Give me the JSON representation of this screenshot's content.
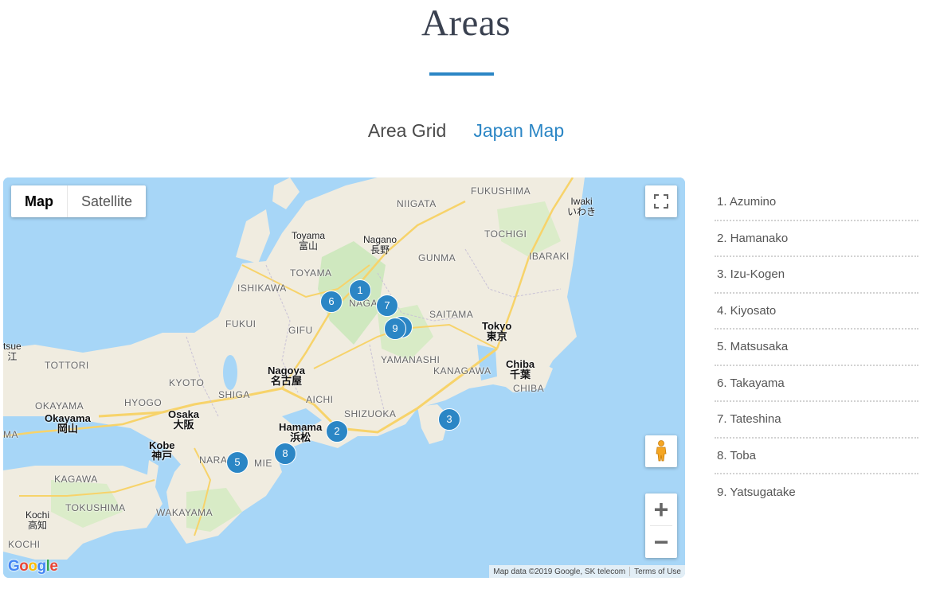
{
  "page": {
    "title": "Areas"
  },
  "tabs": [
    {
      "label": "Area Grid",
      "active": false
    },
    {
      "label": "Japan Map",
      "active": true
    }
  ],
  "colors": {
    "accent": "#2b86c5",
    "water": "#a7d6f7",
    "land": "#f0ece0",
    "park": "#cfe8bf",
    "road": "#f7d36a"
  },
  "map": {
    "type_buttons": [
      "Map",
      "Satellite"
    ],
    "selected_type": "Map",
    "icons": {
      "fullscreen": "fullscreen-icon",
      "pegman": "pegman-icon",
      "zoom_in": "zoom-in-icon",
      "zoom_out": "zoom-out-icon"
    },
    "zoom_in_label": "+",
    "zoom_out_label": "−",
    "google_logo": "Google",
    "attribution": [
      "Map data ©2019 Google, SK telecom",
      "Terms of Use"
    ],
    "markers": [
      "1",
      "2",
      "3",
      "5",
      "6",
      "7",
      "8",
      "9"
    ],
    "labels": {
      "fukushima": "FUKUSHIMA",
      "niigata": "NIIGATA",
      "iwaki": "Iwaki",
      "iwaki_jp": "いわき",
      "tochigi": "TOCHIGI",
      "ibaraki": "IBARAKI",
      "toyama_city": "Toyama",
      "toyama_city_jp": "富山",
      "nagano": "Nagano",
      "nagano_jp": "長野",
      "gunma": "GUNMA",
      "toyama": "TOYAMA",
      "ishikawa": "ISHIKAWA",
      "naga": "NAGA",
      "saitama": "SAITAMA",
      "fukui": "FUKUI",
      "gifu": "GIFU",
      "tokyo": "Tokyo",
      "tokyo_jp": "東京",
      "tsue": "tsue",
      "tsue_jp": "江",
      "tottori": "TOTTORI",
      "yamanashi": "YAMANASHI",
      "kanagawa": "KANAGAWA",
      "chiba_city": "Chiba",
      "chiba_city_jp": "千葉",
      "nagoya": "Nagoya",
      "nagoya_jp": "名古屋",
      "kyoto": "KYOTO",
      "hyogo": "HYOGO",
      "shiga": "SHIGA",
      "aichi": "AICHI",
      "chiba": "CHIBA",
      "okayama_pref": "OKAYAMA",
      "okayama": "Okayama",
      "okayama_jp": "岡山",
      "osaka": "Osaka",
      "osaka_jp": "大阪",
      "shizuoka": "SHIZUOKA",
      "ma": "MA",
      "hamamatsu": "Hamama",
      "hamamatsu_jp": "浜松",
      "kobe": "Kobe",
      "kobe_jp": "神戸",
      "nara": "NARA",
      "mie": "MIE",
      "kagawa": "KAGAWA",
      "tokushima": "TOKUSHIMA",
      "kochi": "Kochi",
      "kochi_jp": "高知",
      "wakayama": "WAKAYAMA",
      "kochi_pref": "KOCHI"
    }
  },
  "areas": [
    "1. Azumino",
    "2. Hamanako",
    "3. Izu-Kogen",
    "4. Kiyosato",
    "5. Matsusaka",
    "6. Takayama",
    "7. Tateshina",
    "8. Toba",
    "9. Yatsugatake"
  ]
}
